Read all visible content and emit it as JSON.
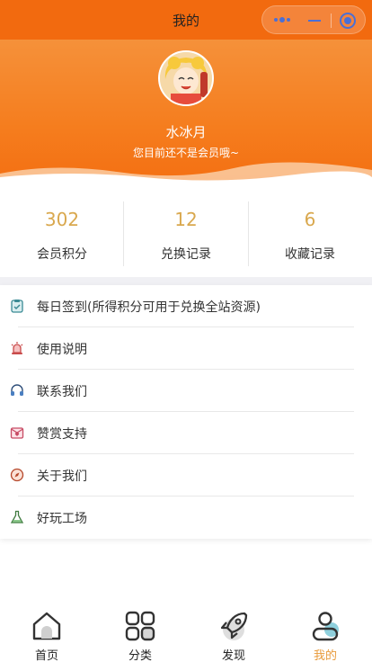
{
  "navbar": {
    "title": "我的",
    "icons": [
      "more-icon",
      "minimize-icon",
      "close-icon"
    ]
  },
  "profile": {
    "username": "水冰月",
    "member_tip": "您目前还不是会员哦~"
  },
  "stats": [
    {
      "value": "302",
      "label": "会员积分"
    },
    {
      "value": "12",
      "label": "兑换记录"
    },
    {
      "value": "6",
      "label": "收藏记录"
    }
  ],
  "menu": [
    {
      "label": "每日签到(所得积分可用于兑换全站资源)",
      "icon": "clipboard-check-icon"
    },
    {
      "label": "使用说明",
      "icon": "alarm-icon"
    },
    {
      "label": "联系我们",
      "icon": "headset-icon"
    },
    {
      "label": "赞赏支持",
      "icon": "mail-heart-icon"
    },
    {
      "label": "关于我们",
      "icon": "compass-icon"
    },
    {
      "label": "好玩工场",
      "icon": "flask-icon"
    }
  ],
  "tabbar": [
    {
      "label": "首页",
      "icon": "home-icon",
      "active": false
    },
    {
      "label": "分类",
      "icon": "grid-icon",
      "active": false
    },
    {
      "label": "发现",
      "icon": "rocket-icon",
      "active": false
    },
    {
      "label": "我的",
      "icon": "user-icon",
      "active": true
    }
  ],
  "colors": {
    "brand_orange": "#f26a0f",
    "stat_value": "#d9a84e",
    "tab_active": "#e89a3a"
  }
}
